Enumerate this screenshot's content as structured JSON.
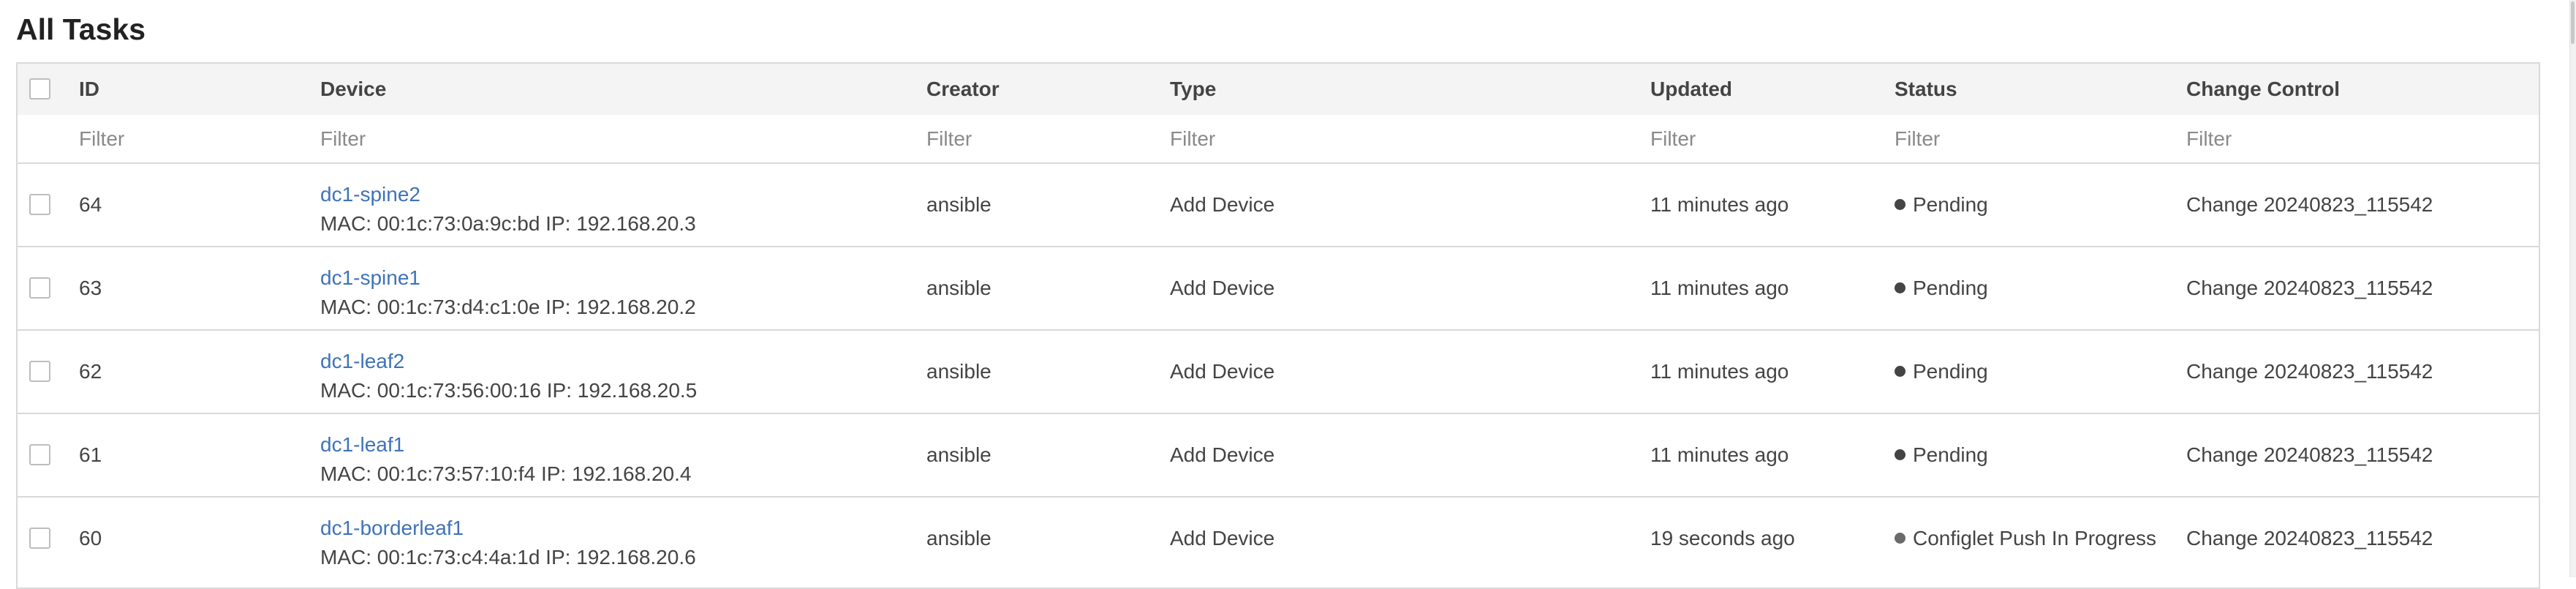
{
  "page_title": "All Tasks",
  "columns": {
    "id": "ID",
    "device": "Device",
    "creator": "Creator",
    "type": "Type",
    "updated": "Updated",
    "status": "Status",
    "change_control": "Change Control"
  },
  "filters": {
    "id": "Filter",
    "device": "Filter",
    "creator": "Filter",
    "type": "Filter",
    "updated": "Filter",
    "status": "Filter",
    "change_control": "Filter"
  },
  "rows": [
    {
      "id": "64",
      "device_name": "dc1-spine2",
      "device_meta": "MAC: 00:1c:73:0a:9c:bd IP: 192.168.20.3",
      "creator": "ansible",
      "type": "Add Device",
      "updated": "11 minutes ago",
      "status": "Pending",
      "change_control": "Change 20240823_115542"
    },
    {
      "id": "63",
      "device_name": "dc1-spine1",
      "device_meta": "MAC: 00:1c:73:d4:c1:0e IP: 192.168.20.2",
      "creator": "ansible",
      "type": "Add Device",
      "updated": "11 minutes ago",
      "status": "Pending",
      "change_control": "Change 20240823_115542"
    },
    {
      "id": "62",
      "device_name": "dc1-leaf2",
      "device_meta": "MAC: 00:1c:73:56:00:16 IP: 192.168.20.5",
      "creator": "ansible",
      "type": "Add Device",
      "updated": "11 minutes ago",
      "status": "Pending",
      "change_control": "Change 20240823_115542"
    },
    {
      "id": "61",
      "device_name": "dc1-leaf1",
      "device_meta": "MAC: 00:1c:73:57:10:f4 IP: 192.168.20.4",
      "creator": "ansible",
      "type": "Add Device",
      "updated": "11 minutes ago",
      "status": "Pending",
      "change_control": "Change 20240823_115542"
    },
    {
      "id": "60",
      "device_name": "dc1-borderleaf1",
      "device_meta": "MAC: 00:1c:73:c4:4a:1d IP: 192.168.20.6",
      "creator": "ansible",
      "type": "Add Device",
      "updated": "19 seconds ago",
      "status": "Configlet Push In Progress",
      "change_control": "Change 20240823_115542"
    }
  ],
  "colors": {
    "link": "#3f73b8",
    "header_bg": "#f4f4f5",
    "border": "#d9d9d9",
    "status_dot": "#444444"
  }
}
